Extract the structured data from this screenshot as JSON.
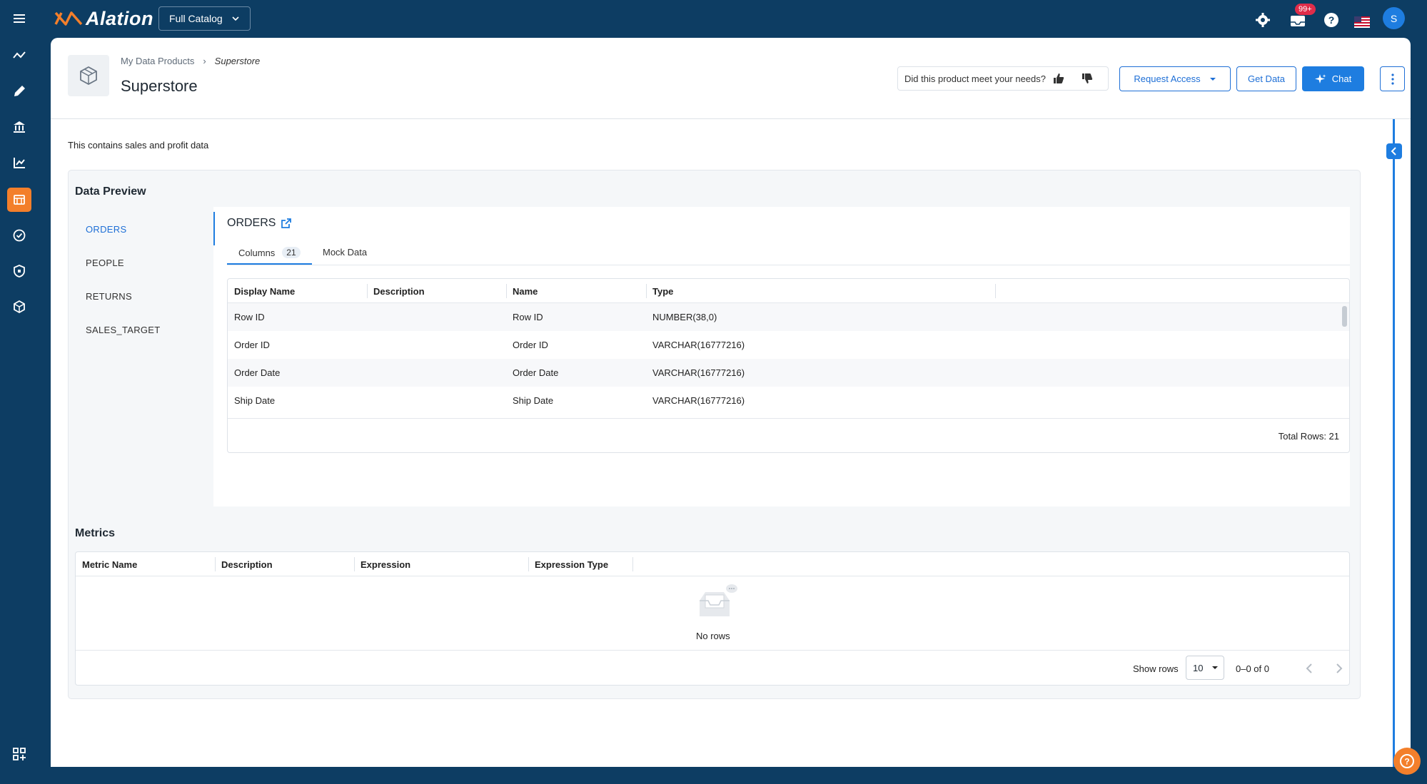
{
  "topbar": {
    "logo": "Alation",
    "catalog_label": "Full Catalog",
    "notifications_badge": "99+",
    "user_initial": "S"
  },
  "header": {
    "breadcrumb_parent": "My Data Products",
    "breadcrumb_separator": "›",
    "breadcrumb_current": "Superstore",
    "title": "Superstore",
    "feedback_prompt": "Did this product meet your needs?",
    "request_access_label": "Request Access",
    "get_data_label": "Get Data",
    "chat_label": "Chat"
  },
  "description": "This contains sales and profit data",
  "data_preview": {
    "title": "Data Preview",
    "tables": [
      "ORDERS",
      "PEOPLE",
      "RETURNS",
      "SALES_TARGET"
    ],
    "selected_table": "ORDERS",
    "tabs": {
      "columns_label": "Columns",
      "columns_count": "21",
      "mock_data_label": "Mock Data"
    },
    "columns_headers": [
      "Display Name",
      "Description",
      "Name",
      "Type"
    ],
    "rows": [
      {
        "display_name": "Row ID",
        "description": "",
        "name": "Row ID",
        "type": "NUMBER(38,0)"
      },
      {
        "display_name": "Order ID",
        "description": "",
        "name": "Order ID",
        "type": "VARCHAR(16777216)"
      },
      {
        "display_name": "Order Date",
        "description": "",
        "name": "Order Date",
        "type": "VARCHAR(16777216)"
      },
      {
        "display_name": "Ship Date",
        "description": "",
        "name": "Ship Date",
        "type": "VARCHAR(16777216)"
      }
    ],
    "total_rows": "Total Rows: 21"
  },
  "metrics": {
    "title": "Metrics",
    "headers": [
      "Metric Name",
      "Description",
      "Expression",
      "Expression Type"
    ],
    "empty_text": "No rows",
    "show_rows_label": "Show rows",
    "rows_per_page": "10",
    "range_text": "0–0 of 0"
  },
  "colors": {
    "navy": "#0d3d63",
    "accent_blue": "#1e7de0",
    "active_orange": "#f37f2b",
    "badge_red": "#e02d4a"
  },
  "icons": {
    "nav": [
      "activity-icon",
      "compose-icon",
      "library-icon",
      "analytics-icon",
      "data-products-icon",
      "verified-icon",
      "governance-icon",
      "packages-icon"
    ],
    "bottom_nav": "apps-icon"
  }
}
